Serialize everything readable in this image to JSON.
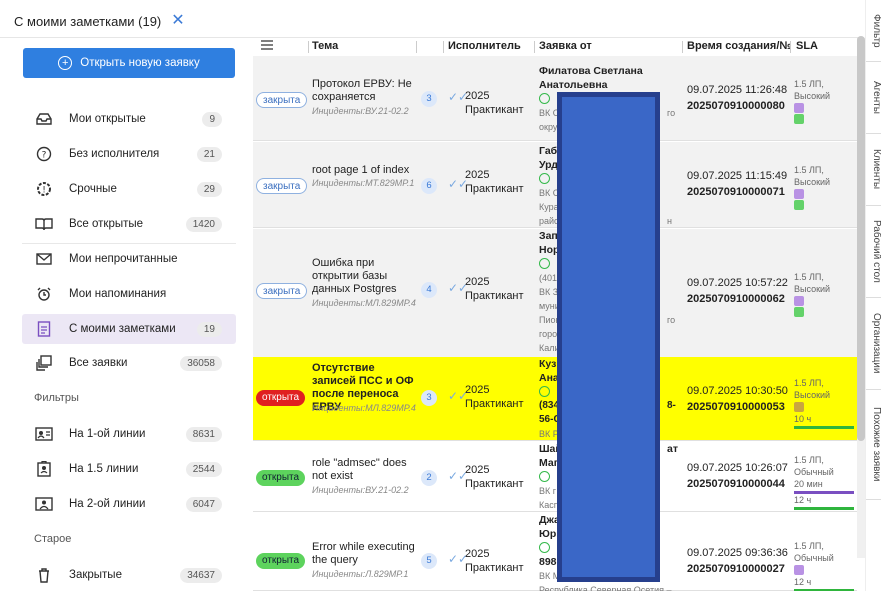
{
  "tab": {
    "title": "С моими заметками (19)",
    "close": "✕"
  },
  "sidebar": {
    "open_button": "Открыть новую заявку",
    "items": [
      {
        "label": "Мои открытые",
        "count": "9"
      },
      {
        "label": "Без исполнителя",
        "count": "21"
      },
      {
        "label": "Срочные",
        "count": "29"
      },
      {
        "label": "Все открытые",
        "count": "1420"
      },
      {
        "label": "Мои непрочитанные",
        "count": ""
      },
      {
        "label": "Мои напоминания",
        "count": ""
      },
      {
        "label": "С моими заметками",
        "count": "19"
      },
      {
        "label": "Все заявки",
        "count": "36058"
      }
    ],
    "filters_title": "Фильтры",
    "filters": [
      {
        "label": "На 1-ой линии",
        "count": "8631"
      },
      {
        "label": "На 1.5 линии",
        "count": "2544"
      },
      {
        "label": "На 2-ой линии",
        "count": "6047"
      }
    ],
    "old_title": "Старое",
    "old": [
      {
        "label": "Закрытые",
        "count": "34637"
      }
    ]
  },
  "table": {
    "headers": {
      "subject": "Тема",
      "assignee": "Исполнитель",
      "applicant": "Заявка от",
      "created": "Время создания/№",
      "sla": "SLA"
    },
    "rows": [
      {
        "status": "закрыта",
        "subject": "Протокол ЕРВУ: Не сохраняется",
        "incident": "Инциденты:ВУ.21-02.2",
        "num": "3",
        "assignee1": "2025",
        "assignee2": "Практикант",
        "applicant_name": "Филатова Светлана Анатольевна",
        "applicant_lines": [
          "ВК О",
          "окру",
          "го"
        ],
        "created_time": "09.07.2025 11:26:48",
        "created_num": "2025070910000080",
        "sla_text": "1.5 ЛП, Высокий"
      },
      {
        "status": "закрыта",
        "subject": "root page 1 of index",
        "incident": "Инциденты:МТ.829МР.1",
        "num": "6",
        "assignee1": "2025",
        "assignee2": "Практикант",
        "applicant_name": "Габ Урд",
        "applicant_lines": [
          "ВК С",
          "Кура",
          "райс",
          "н"
        ],
        "created_time": "09.07.2025 11:15:49",
        "created_num": "2025070910000071",
        "sla_text": "1.5 ЛП, Высокий"
      },
      {
        "status": "закрыта",
        "subject": "Ошибка при открытии базы данных Postgres",
        "incident": "Инциденты:МЛ.829МР.4",
        "num": "4",
        "assignee1": "2025",
        "assignee2": "Практикант",
        "applicant_name": "Зап Нор",
        "applicant_lines": [
          "(401",
          "ВК З",
          "муни",
          "Пион",
          "горо",
          "Кали",
          "го"
        ],
        "created_time": "09.07.2025 10:57:22",
        "created_num": "2025070910000062",
        "sla_text": "1.5 ЛП, Высокий"
      },
      {
        "status": "открыта",
        "subject": "Отсутствие записей ПСС и ОФ после переноса ЕРВУ",
        "incident": "Инциденты:МЛ.829МР.4",
        "num": "3",
        "assignee1": "2025",
        "assignee2": "Практикант",
        "applicant_name": "Куз Ана",
        "applicant_lines": [
          "(834",
          "56-С",
          "ВК Р",
          "8-"
        ],
        "created_time": "09.07.2025 10:30:50",
        "created_num": "2025070910000053",
        "sla_text": "1.5 ЛП, Высокий",
        "sla_extra": "10 ч"
      },
      {
        "status": "открыта",
        "subject": "role \"admsec\" does not exist",
        "incident": "Инциденты:ВУ.21-02.2",
        "num": "2",
        "assignee1": "2025",
        "assignee2": "Практикант",
        "applicant_name": "Шай Маг",
        "applicant_lines": [
          "ВК г",
          "Касп",
          "ат"
        ],
        "created_time": "09.07.2025 10:26:07",
        "created_num": "2025070910000044",
        "sla_text": "1.5 ЛП, Обычный",
        "sla_extra": "20 мин",
        "sla_extra2": "12 ч"
      },
      {
        "status": "открыта",
        "subject": "Error while executing the query",
        "incident": "Инциденты:Л.829МР.1",
        "num": "5",
        "assignee1": "2025",
        "assignee2": "Практикант",
        "applicant_name": "Джа Юрь",
        "applicant_lines": [
          "898",
          "ВК М",
          "Республика Северная Осетия –"
        ],
        "created_time": "09.07.2025 09:36:36",
        "created_num": "2025070910000027",
        "sla_text": "1.5 ЛП, Обычный",
        "sla_extra": "12 ч"
      }
    ]
  },
  "right_tabs": [
    "Фильтр",
    "Агенты",
    "Клиенты",
    "Рабочий стол",
    "Организации",
    "Похожие заявки"
  ],
  "colors": {
    "accent": "#2f7fe0",
    "row_highlight": "#ffff00",
    "status_open_red": "#e02020",
    "status_open_green": "#5dd35d",
    "redaction": "#3a67c7"
  }
}
